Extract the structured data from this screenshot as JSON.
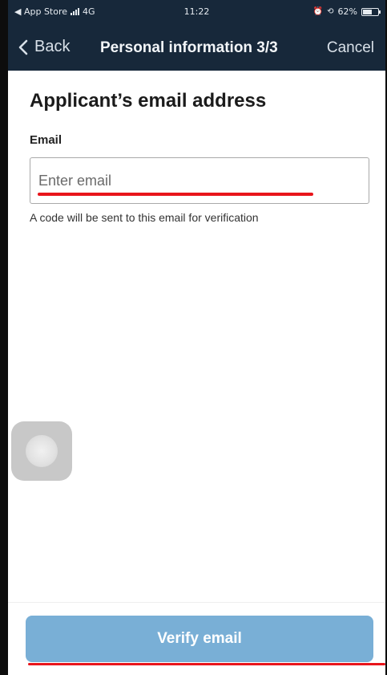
{
  "status_bar": {
    "back_app": "◀ App Store",
    "network": "4G",
    "time": "11:22",
    "alarm_icon": "⏰",
    "rotation_lock_icon": "⟲",
    "battery_percent": "62%",
    "battery_level": 0.62
  },
  "nav": {
    "back_label": "Back",
    "title": "Personal information 3/3",
    "cancel_label": "Cancel"
  },
  "form": {
    "heading": "Applicant’s email address",
    "email_label": "Email",
    "email_placeholder": "Enter email",
    "email_value": "",
    "hint": "A code will be sent to this email for verification"
  },
  "actions": {
    "verify_label": "Verify email"
  },
  "colors": {
    "header_bg": "#17283a",
    "button_bg": "#79afd6",
    "annotation_red": "#e8151b"
  }
}
